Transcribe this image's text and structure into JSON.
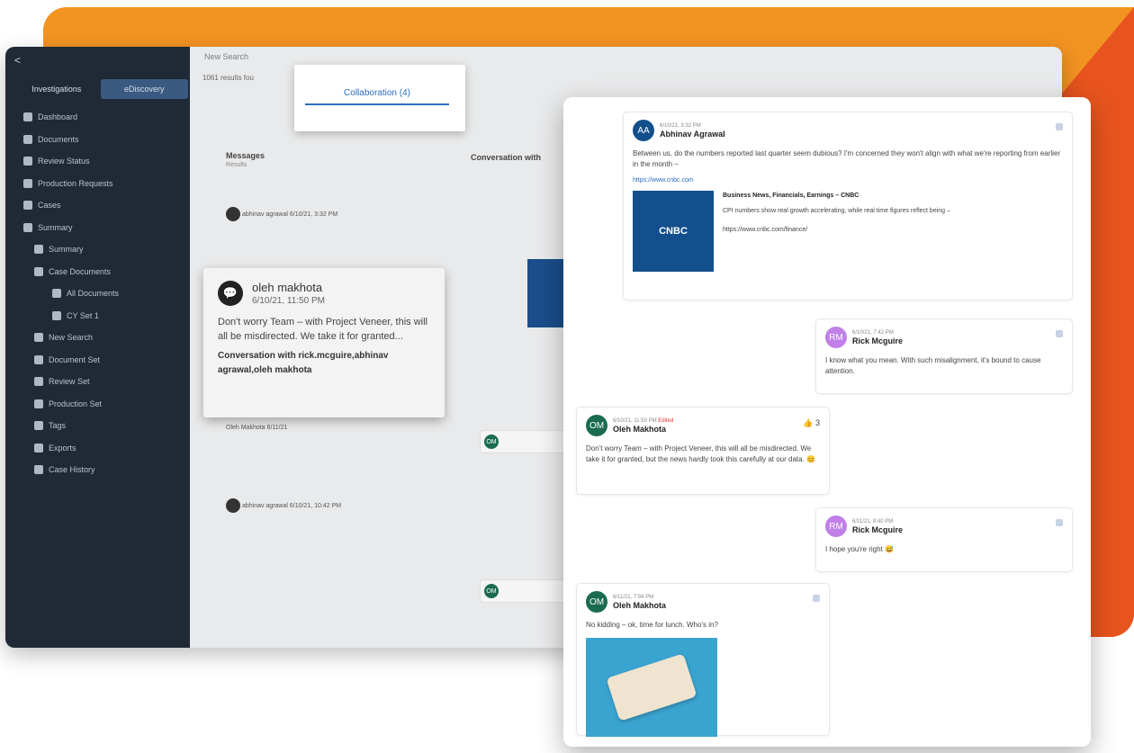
{
  "sidebar": {
    "back": "<",
    "tabs": [
      "Investigations",
      "eDiscovery"
    ],
    "items": [
      {
        "label": "Dashboard",
        "level": 0
      },
      {
        "label": "Documents",
        "level": 0
      },
      {
        "label": "Review Status",
        "level": 0
      },
      {
        "label": "Production Requests",
        "level": 0
      },
      {
        "label": "Cases",
        "level": 0
      },
      {
        "label": "Summary",
        "level": 0
      },
      {
        "label": "Summary",
        "level": 1
      },
      {
        "label": "Case Documents",
        "level": 1
      },
      {
        "label": "All Documents",
        "level": 2
      },
      {
        "label": "CY Set 1",
        "level": 2
      },
      {
        "label": "New Search",
        "level": 1
      },
      {
        "label": "Document Set",
        "level": 1
      },
      {
        "label": "Review Set",
        "level": 1
      },
      {
        "label": "Production Set",
        "level": 1
      },
      {
        "label": "Tags",
        "level": 1
      },
      {
        "label": "Exports",
        "level": 1
      },
      {
        "label": "Case History",
        "level": 1
      }
    ]
  },
  "main": {
    "breadcrumb": "New Search",
    "results_label": "1061 results fou",
    "messages_header": "Messages",
    "messages_sub": "Results",
    "conversation_header": "Conversation with",
    "msg_items": [
      {
        "name": "abhinav agrawal",
        "date": "6/10/21, 3:32 PM"
      },
      {
        "name": "Oleh Makhota",
        "date": "6/11/21"
      },
      {
        "name": "abhinav agrawal",
        "date": "6/10/21, 10:42 PM"
      }
    ]
  },
  "collab_popup": {
    "tab": "Collaboration (4)"
  },
  "tooltip": {
    "name": "oleh makhota",
    "date": "6/10/21, 11:50 PM",
    "body": "Don't worry Team – with Project Veneer, this will all be misdirected.  We take it for granted...",
    "conversation": "Conversation with rick.mcguire,abhinav agrawal,oleh makhota"
  },
  "chat": {
    "messages": [
      {
        "initials": "AA",
        "timestamp": "6/10/21, 3:32 PM",
        "sender": "Abhinav Agrawal",
        "text": "Between us, do the numbers reported last quarter seem dubious? I'm concerned they won't align with what we're reporting from earlier in the month –",
        "link": "https://www.cnbc.com",
        "card_title": "Business News, Financials, Earnings – CNBC",
        "card_desc": "CPI numbers show real growth accelerating, while real time figures reflect being –",
        "card_url": "https://www.cnbc.com/finance/",
        "card_logo": "CNBC"
      },
      {
        "initials": "RM",
        "timestamp": "6/10/21, 7:42 PM",
        "sender": "Rick Mcguire",
        "text": "I know what you mean. With such misalignment, it's bound to cause attention."
      },
      {
        "initials": "OM",
        "timestamp": "6/10/21, 11:50 PM",
        "edited": "Edited",
        "sender": "Oleh Makhota",
        "reaction": "👍 3",
        "text": "Don't worry Team – with Project Veneer, this will all be misdirected. We take it for granted, but the news hardly took this carefully at our data. 😊"
      },
      {
        "initials": "RM",
        "timestamp": "6/11/21, 8:40 PM",
        "sender": "Rick Mcguire",
        "text": "I hope you're right 😅"
      },
      {
        "initials": "OM",
        "timestamp": "6/11/21, 7:56 PM",
        "sender": "Oleh Makhota",
        "text": "No kidding – ok, time for lunch. Who's in?"
      }
    ]
  },
  "colors": {
    "orange": "#f39322",
    "dark_orange": "#e8541e",
    "sidebar": "#1f2a36",
    "accent_blue": "#2b6cc1"
  }
}
